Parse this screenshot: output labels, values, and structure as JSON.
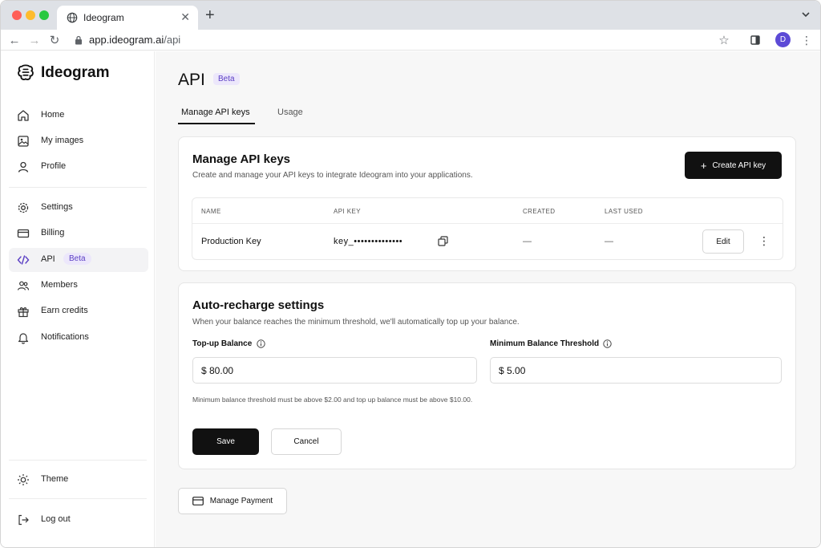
{
  "browser": {
    "tab_title": "Ideogram",
    "url_host": "app.ideogram.ai",
    "url_path": "/api",
    "profile_initial": "D"
  },
  "sidebar": {
    "brand": "Ideogram",
    "items": [
      {
        "label": "Home",
        "icon": "home-icon"
      },
      {
        "label": "My images",
        "icon": "image-icon"
      },
      {
        "label": "Profile",
        "icon": "user-icon"
      },
      {
        "label": "Settings",
        "icon": "gear-icon"
      },
      {
        "label": "Billing",
        "icon": "billing-icon"
      },
      {
        "label": "API",
        "icon": "code-icon",
        "badge": "Beta",
        "active": true
      },
      {
        "label": "Members",
        "icon": "members-icon"
      },
      {
        "label": "Earn credits",
        "icon": "gift-icon"
      },
      {
        "label": "Notifications",
        "icon": "bell-icon"
      }
    ],
    "bottom": [
      {
        "label": "Theme",
        "icon": "sun-icon"
      },
      {
        "label": "Log out",
        "icon": "logout-icon"
      }
    ]
  },
  "page": {
    "title": "API",
    "title_badge": "Beta",
    "tabs": [
      {
        "label": "Manage API keys",
        "active": true
      },
      {
        "label": "Usage",
        "active": false
      }
    ]
  },
  "api_keys": {
    "title": "Manage API keys",
    "subtitle": "Create and manage your API keys to integrate Ideogram into your applications.",
    "create_button": "Create API key",
    "columns": [
      "NAME",
      "API KEY",
      "CREATED",
      "LAST USED"
    ],
    "rows": [
      {
        "name": "Production Key",
        "key": "key_••••••••••••••",
        "created": "—",
        "last_used": "—",
        "edit_label": "Edit"
      }
    ]
  },
  "auto_recharge": {
    "title": "Auto-recharge settings",
    "subtitle": "When your balance reaches the minimum threshold, we'll automatically top up your balance.",
    "topup_label": "Top-up Balance",
    "topup_value": "$ 80.00",
    "threshold_label": "Minimum Balance Threshold",
    "threshold_value": "$ 5.00",
    "hint": "Minimum balance threshold must be above $2.00 and top up balance must be above $10.00.",
    "save_label": "Save",
    "cancel_label": "Cancel"
  },
  "payment": {
    "manage_label": "Manage Payment"
  },
  "colors": {
    "accent": "#5b3fc4",
    "badge_bg": "#ece7fb",
    "primary_button": "#111111"
  }
}
